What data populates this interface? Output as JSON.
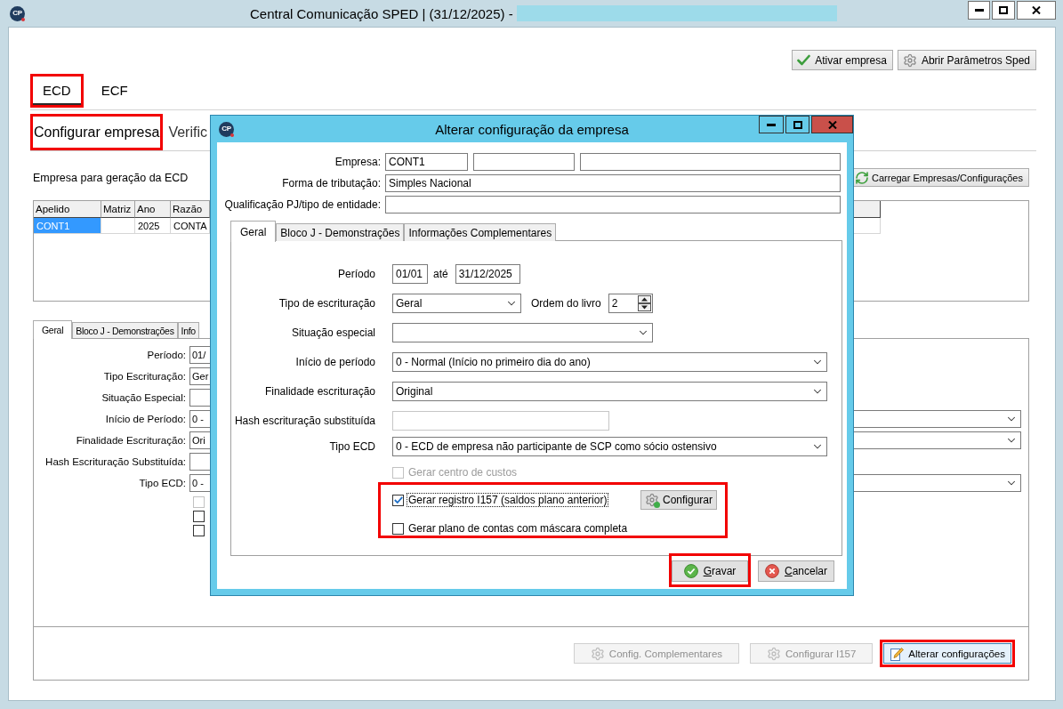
{
  "window": {
    "logo": "CP",
    "title": "Central Comunicação SPED | (31/12/2025) -",
    "title_redacted": true
  },
  "toolbar_buttons": [
    {
      "kind": "check",
      "label": "Ativar empresa"
    },
    {
      "kind": "gear",
      "label": "Abrir Parâmetros Sped"
    }
  ],
  "module_tabs": [
    {
      "label": "ECD",
      "selected": true,
      "highlighted": true
    },
    {
      "label": "ECF",
      "selected": false,
      "highlighted": false
    }
  ],
  "section_tabs": [
    {
      "label": "Configurar empresa",
      "selected": true,
      "highlighted": true
    },
    {
      "label": "Verific",
      "selected": false,
      "highlighted": false
    }
  ],
  "company_section": {
    "title": "Empresa para geração da ECD",
    "load_button": "Carregar Empresas/Configurações"
  },
  "company_table": {
    "columns": [
      "Apelido",
      "Matriz",
      "Ano",
      "Razão"
    ],
    "rows": [
      {
        "cells": [
          {
            "text": "CONT1",
            "selected": true
          },
          {
            "selected": false
          },
          {
            "text": "2025",
            "selected": false
          },
          {
            "text": "CONTA",
            "selected": false
          }
        ]
      }
    ]
  },
  "settings_tabs": [
    {
      "label": "Geral",
      "selected": true
    },
    {
      "label": "Bloco J - Demonstrações",
      "selected": false
    },
    {
      "label": "Info",
      "selected": false
    }
  ],
  "settings_form": {
    "fields": [
      {
        "label": "Período:",
        "kind": "box",
        "value": "01/"
      },
      {
        "label": "Tipo Escrituração:",
        "kind": "box",
        "value": "Ger"
      },
      {
        "label": "Situação Especial:",
        "kind": "box"
      },
      {
        "label": "Início de Período:",
        "kind": "select",
        "value": "0 -"
      },
      {
        "label": "Finalidade Escrituração:",
        "kind": "select",
        "value": "Ori"
      },
      {
        "label": "Hash Escrituração Substituída:",
        "kind": "box"
      },
      {
        "label": "Tipo ECD:",
        "kind": "select",
        "value": "0 -"
      }
    ],
    "checkboxes": [
      {
        "checked": false,
        "disabled": true
      },
      {
        "checked": false,
        "disabled": false
      },
      {
        "checked": false,
        "disabled": false
      }
    ]
  },
  "footer_buttons": [
    {
      "kind": "gear",
      "label": "Config. Complementares",
      "disabled": true,
      "focused": false,
      "highlighted": false
    },
    {
      "kind": "gear",
      "label": "Configurar I157",
      "disabled": true,
      "focused": false,
      "highlighted": false
    },
    {
      "kind": "edit",
      "label": "Alterar configurações",
      "disabled": false,
      "focused": true,
      "highlighted": true
    }
  ],
  "dialog": {
    "logo": "CP",
    "title": "Alterar configuração da empresa",
    "company": {
      "label": "Empresa:",
      "fields": [
        {
          "kind": "short",
          "value": "CONT1"
        },
        {
          "kind": "medium"
        },
        {
          "kind": "wide"
        }
      ]
    },
    "tax_regime": {
      "label": "Forma de tributação:",
      "value": "Simples Nacional"
    },
    "entity_type": {
      "label": "Qualificação PJ/tipo de entidade:"
    },
    "tabs": [
      {
        "label": "Geral",
        "selected": true
      },
      {
        "label": "Bloco J - Demonstrações",
        "selected": false
      },
      {
        "label": "Informações Complementares",
        "selected": false
      }
    ],
    "period": {
      "label": "Período",
      "start": "01/01",
      "separator": "até",
      "end": "31/12/2025"
    },
    "bookkeeping_type": {
      "label": "Tipo de escrituração",
      "value": "Geral"
    },
    "book_order": {
      "label": "Ordem do livro",
      "value": "2"
    },
    "special_situation": {
      "label": "Situação especial"
    },
    "period_start": {
      "label": "Início de período",
      "value": "0 - Normal (Início no primeiro dia do ano)"
    },
    "purpose": {
      "label": "Finalidade escrituração",
      "value": "Original"
    },
    "replaced_hash": {
      "label": "Hash escrituração substituída",
      "disabled": true
    },
    "ecd_type": {
      "label": "Tipo ECD",
      "value": "0 - ECD de empresa não participante de SCP como sócio ostensivo"
    },
    "option_groups": [
      {
        "highlighted": false,
        "options": [
          {
            "label": "Gerar centro de custos",
            "checked": false,
            "disabled": true,
            "focused": false
          }
        ]
      },
      {
        "highlighted": true,
        "options": [
          {
            "label": "Gerar registro I157 (saldos plano anterior)",
            "checked": true,
            "disabled": false,
            "focused": true,
            "button": "Configurar"
          },
          {
            "label": "Gerar plano de contas com máscara completa",
            "checked": false,
            "disabled": false,
            "focused": false
          }
        ]
      }
    ],
    "buttons": [
      {
        "kind": "save",
        "label": "Gravar",
        "highlighted": true
      },
      {
        "kind": "cancel",
        "label": "Cancelar",
        "highlighted": false
      }
    ]
  }
}
